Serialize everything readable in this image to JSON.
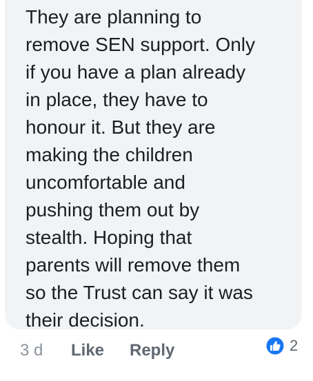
{
  "comment": {
    "lines": [
      "They are planning to",
      "remove SEN support. Only",
      "if you have a plan already",
      "in place, they have to",
      "honour it. But they are",
      "making the children",
      "uncomfortable and",
      "pushing them out by",
      "stealth. Hoping that",
      "parents will remove them",
      "so the Trust can say it was",
      "their decision."
    ]
  },
  "actions": {
    "timestamp": "3 d",
    "like_label": "Like",
    "reply_label": "Reply"
  },
  "reactions": {
    "icon": "thumbs-up-icon",
    "count": "2",
    "accent": "#1877f2"
  },
  "colors": {
    "bubble": "#f2f3f5",
    "text": "#1c1e21",
    "muted": "#606770"
  }
}
